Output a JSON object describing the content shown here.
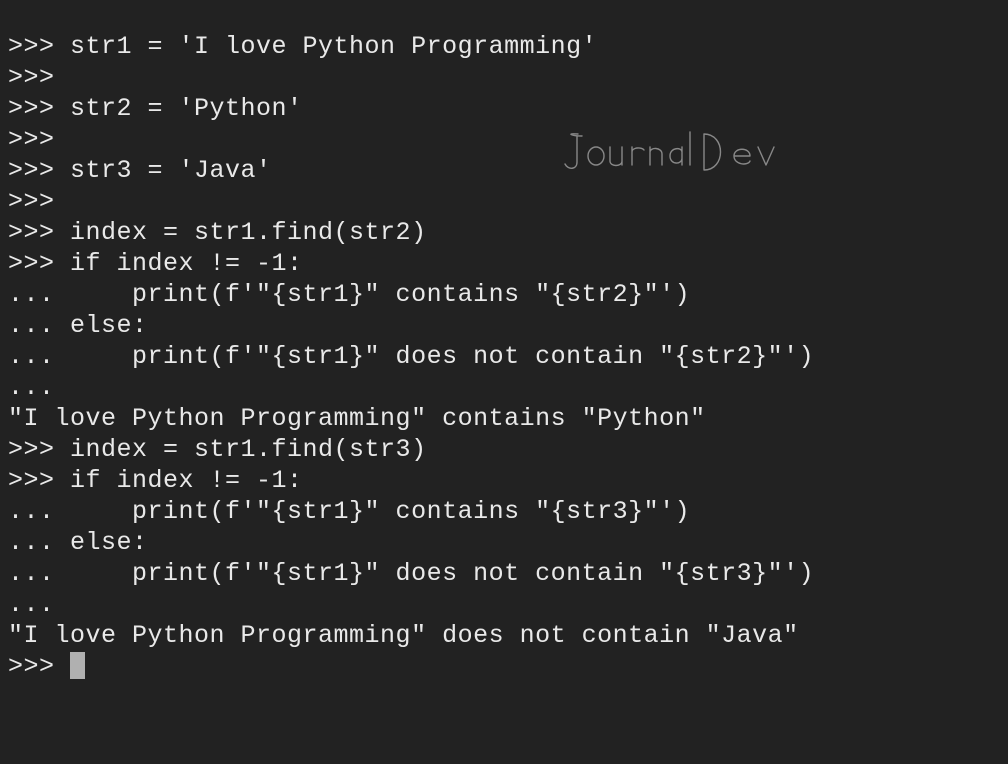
{
  "lines": [
    ">>> str1 = 'I love Python Programming'",
    ">>> ",
    ">>> str2 = 'Python'",
    ">>> ",
    ">>> str3 = 'Java'",
    ">>> ",
    ">>> index = str1.find(str2)",
    ">>> if index != -1:",
    "...     print(f'\"{str1}\" contains \"{str2}\"')",
    "... else:",
    "...     print(f'\"{str1}\" does not contain \"{str2}\"')",
    "... ",
    "\"I love Python Programming\" contains \"Python\"",
    ">>> index = str1.find(str3)",
    ">>> if index != -1:",
    "...     print(f'\"{str1}\" contains \"{str3}\"')",
    "... else:",
    "...     print(f'\"{str1}\" does not contain \"{str3}\"')",
    "... ",
    "\"I love Python Programming\" does not contain \"Java\"",
    ">>> "
  ],
  "watermark": "JournalDev"
}
